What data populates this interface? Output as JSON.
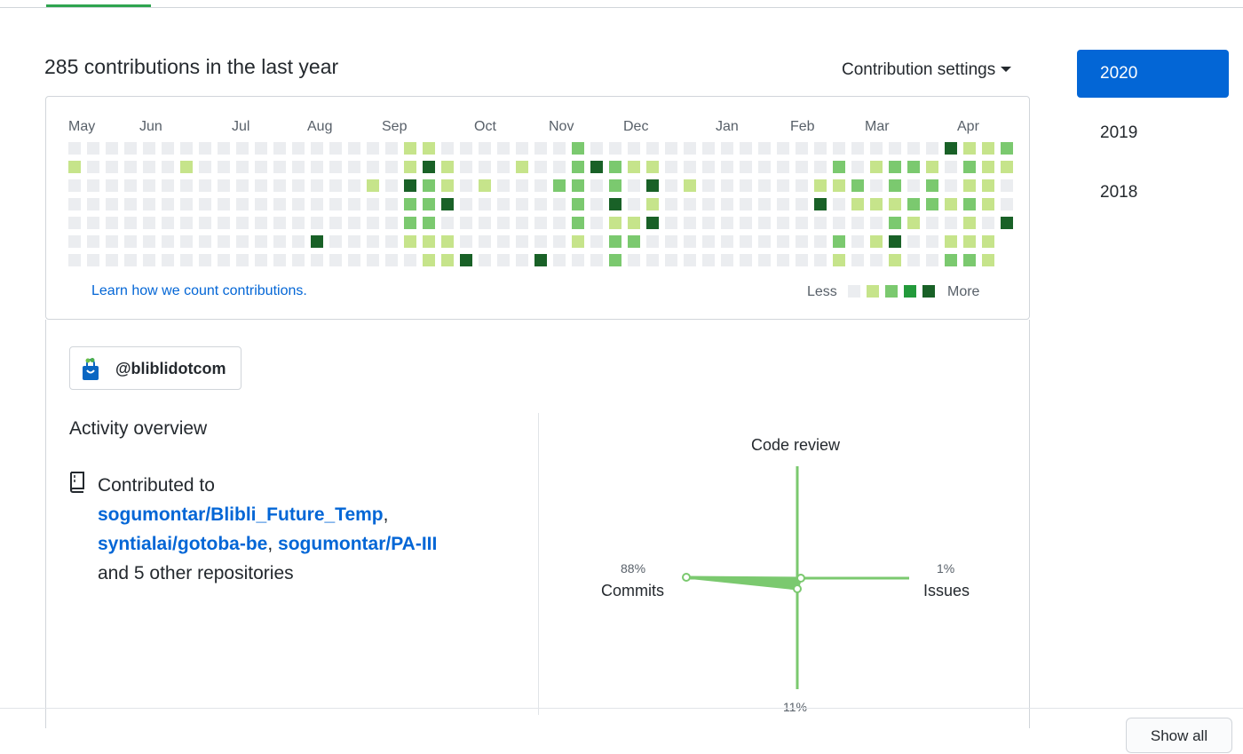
{
  "header": {
    "contributions_title": "285 contributions in the last year",
    "settings_label": "Contribution settings"
  },
  "graph": {
    "months": [
      "May",
      "Jun",
      "Jul",
      "Aug",
      "Sep",
      "Oct",
      "Nov",
      "Dec",
      "Jan",
      "Feb",
      "Mar",
      "Apr"
    ],
    "levels_note": "weeks x 7 days, level 0-4",
    "weeks": [
      [
        0,
        1,
        0,
        0,
        0,
        0,
        0
      ],
      [
        0,
        0,
        0,
        0,
        0,
        0,
        0
      ],
      [
        0,
        0,
        0,
        0,
        0,
        0,
        0
      ],
      [
        0,
        0,
        0,
        0,
        0,
        0,
        0
      ],
      [
        0,
        0,
        0,
        0,
        0,
        0,
        0
      ],
      [
        0,
        0,
        0,
        0,
        0,
        0,
        0
      ],
      [
        0,
        1,
        0,
        0,
        0,
        0,
        0
      ],
      [
        0,
        0,
        0,
        0,
        0,
        0,
        0
      ],
      [
        0,
        0,
        0,
        0,
        0,
        0,
        0
      ],
      [
        0,
        0,
        0,
        0,
        0,
        0,
        0
      ],
      [
        0,
        0,
        0,
        0,
        0,
        0,
        0
      ],
      [
        0,
        0,
        0,
        0,
        0,
        0,
        0
      ],
      [
        0,
        0,
        0,
        0,
        0,
        0,
        0
      ],
      [
        0,
        0,
        0,
        0,
        0,
        4,
        0
      ],
      [
        0,
        0,
        0,
        0,
        0,
        0,
        0
      ],
      [
        0,
        0,
        0,
        0,
        0,
        0,
        0
      ],
      [
        0,
        0,
        1,
        0,
        0,
        0,
        0
      ],
      [
        0,
        0,
        0,
        0,
        0,
        0,
        0
      ],
      [
        1,
        1,
        4,
        2,
        2,
        1,
        0
      ],
      [
        1,
        4,
        2,
        2,
        2,
        1,
        1
      ],
      [
        0,
        1,
        1,
        4,
        0,
        1,
        1
      ],
      [
        0,
        0,
        0,
        0,
        0,
        0,
        4
      ],
      [
        0,
        0,
        1,
        0,
        0,
        0,
        0
      ],
      [
        0,
        0,
        0,
        0,
        0,
        0,
        0
      ],
      [
        0,
        1,
        0,
        0,
        0,
        0,
        0
      ],
      [
        0,
        0,
        0,
        0,
        0,
        0,
        4
      ],
      [
        0,
        0,
        2,
        0,
        0,
        0,
        0
      ],
      [
        2,
        2,
        2,
        2,
        2,
        1,
        0
      ],
      [
        0,
        4,
        0,
        0,
        0,
        0,
        0
      ],
      [
        0,
        2,
        2,
        4,
        1,
        2,
        2
      ],
      [
        0,
        1,
        0,
        0,
        1,
        2,
        0
      ],
      [
        0,
        1,
        4,
        1,
        4,
        0,
        0
      ],
      [
        0,
        0,
        0,
        0,
        0,
        0,
        0
      ],
      [
        0,
        0,
        1,
        0,
        0,
        0,
        0
      ],
      [
        0,
        0,
        0,
        0,
        0,
        0,
        0
      ],
      [
        0,
        0,
        0,
        0,
        0,
        0,
        0
      ],
      [
        0,
        0,
        0,
        0,
        0,
        0,
        0
      ],
      [
        0,
        0,
        0,
        0,
        0,
        0,
        0
      ],
      [
        0,
        0,
        0,
        0,
        0,
        0,
        0
      ],
      [
        0,
        0,
        0,
        0,
        0,
        0,
        0
      ],
      [
        0,
        0,
        1,
        4,
        0,
        0,
        0
      ],
      [
        0,
        2,
        1,
        0,
        0,
        2,
        1
      ],
      [
        0,
        0,
        2,
        1,
        0,
        0,
        0
      ],
      [
        0,
        1,
        0,
        1,
        0,
        1,
        0
      ],
      [
        0,
        2,
        2,
        1,
        2,
        4,
        1
      ],
      [
        0,
        2,
        0,
        2,
        1,
        0,
        0
      ],
      [
        0,
        1,
        2,
        2,
        0,
        0,
        0
      ],
      [
        4,
        0,
        0,
        1,
        0,
        1,
        2
      ],
      [
        1,
        2,
        1,
        2,
        1,
        1,
        2
      ],
      [
        1,
        1,
        1,
        1,
        0,
        1,
        1
      ],
      [
        2,
        1,
        0,
        0,
        4,
        0,
        0
      ]
    ],
    "colors": [
      "#ebedf0",
      "#c6e48b",
      "#7bc96f",
      "#239a3b",
      "#196127"
    ],
    "learn_link": "Learn how we count contributions.",
    "legend_less": "Less",
    "legend_more": "More"
  },
  "org": {
    "handle": "@bliblidotcom",
    "avatar_icon": "shopping-bag-icon"
  },
  "activity": {
    "title": "Activity overview",
    "contributed_to": "Contributed to",
    "repos": [
      "sogumontar/Blibli_Future_Temp",
      "syntialai/gotoba-be",
      "sogumontar/PA-III"
    ],
    "separators": [
      ",",
      ","
    ],
    "others": "and 5 other repositories",
    "icon": "repo-icon"
  },
  "radar": {
    "code_review_label": "Code review",
    "commits_label": "Commits",
    "commits_pct": "88%",
    "issues_label": "Issues",
    "issues_pct": "1%",
    "pull_requests_pct": "11%",
    "color": "#7bc96f"
  },
  "years": [
    "2020",
    "2019",
    "2018"
  ],
  "active_year": "2020",
  "show_more_label": "Show all"
}
